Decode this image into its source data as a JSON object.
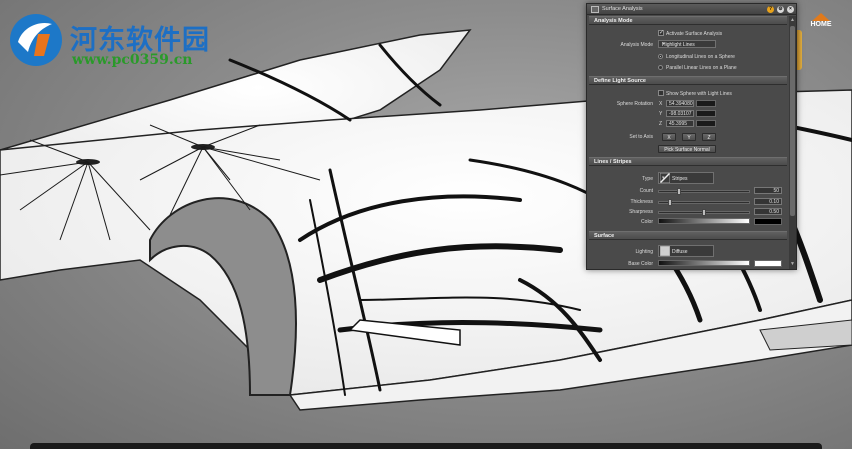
{
  "watermark": {
    "site_name": "河东软件园",
    "url": "www.pc0359.cn"
  },
  "navigation": {
    "home_label": "HOME"
  },
  "panel": {
    "title": "Surface Analysis",
    "analysis_mode": {
      "heading": "Analysis Mode",
      "activate_label": "Activate Surface Analysis",
      "activate_checked": true,
      "mode_label": "Analysis Mode",
      "mode_value": "Highlight Lines",
      "radio_sphere": "Longitudinal Lines on a Sphere",
      "radio_plane": "Parallel Linear Lines on a Plane",
      "selected": "sphere"
    },
    "light_source": {
      "heading": "Define Light Source",
      "show_sphere_label": "Show Sphere with Light Lines",
      "show_sphere_checked": false,
      "rotation_label": "Sphere Rotation",
      "x_label": "X",
      "x_value": "54.394080",
      "y_label": "Y",
      "y_value": "-98.03107",
      "z_label": "Z",
      "z_value": "45.3995",
      "set_axis_label": "Set to Axis",
      "axis_x": "X",
      "axis_y": "Y",
      "axis_z": "Z",
      "pick_button": "Pick Surface Normal"
    },
    "lines": {
      "heading": "Lines / Stripes",
      "type_label": "Type",
      "type_value": "Stripes",
      "count_label": "Count",
      "count_value": "50",
      "count_fraction": 0.21,
      "thickness_label": "Thickness",
      "thickness_value": "0.10",
      "thickness_fraction": 0.11,
      "sharpness_label": "Sharpness",
      "sharpness_value": "0.50",
      "sharpness_fraction": 0.5,
      "color_label": "Color"
    },
    "surface": {
      "heading": "Surface",
      "lighting_label": "Lighting",
      "lighting_value": "Diffuse",
      "base_color_label": "Base Color"
    }
  },
  "colors": {
    "panel_bg": "#4a4a4a",
    "watermark_blue": "#1d6fc4",
    "watermark_green": "#2a9a2a",
    "home_orange": "#e07a1c"
  }
}
